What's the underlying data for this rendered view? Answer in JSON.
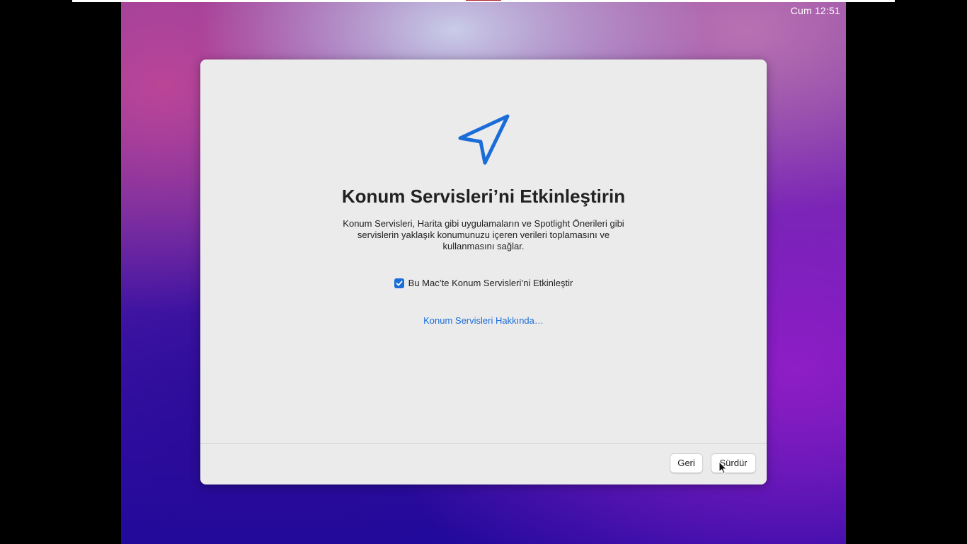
{
  "menubar": {
    "clock": "Cum 12:51"
  },
  "dialog": {
    "icon": "location-arrow-icon",
    "title": "Konum Servisleri’ni Etkinleştirin",
    "description": "Konum Servisleri, Harita gibi uygulamaların ve Spotlight Önerileri gibi servislerin yaklaşık konumunuzu içeren verileri toplamasını ve kullanmasını sağlar.",
    "checkbox": {
      "label": "Bu Mac’te Konum Servisleri’ni Etkinleştir",
      "checked": true
    },
    "about_link": "Konum Servisleri Hakkında…",
    "buttons": {
      "back": "Geri",
      "continue": "Sürdür"
    }
  },
  "colors": {
    "accent": "#1a6dd8",
    "dialog_background": "#ebebeb",
    "text": "#222222"
  }
}
